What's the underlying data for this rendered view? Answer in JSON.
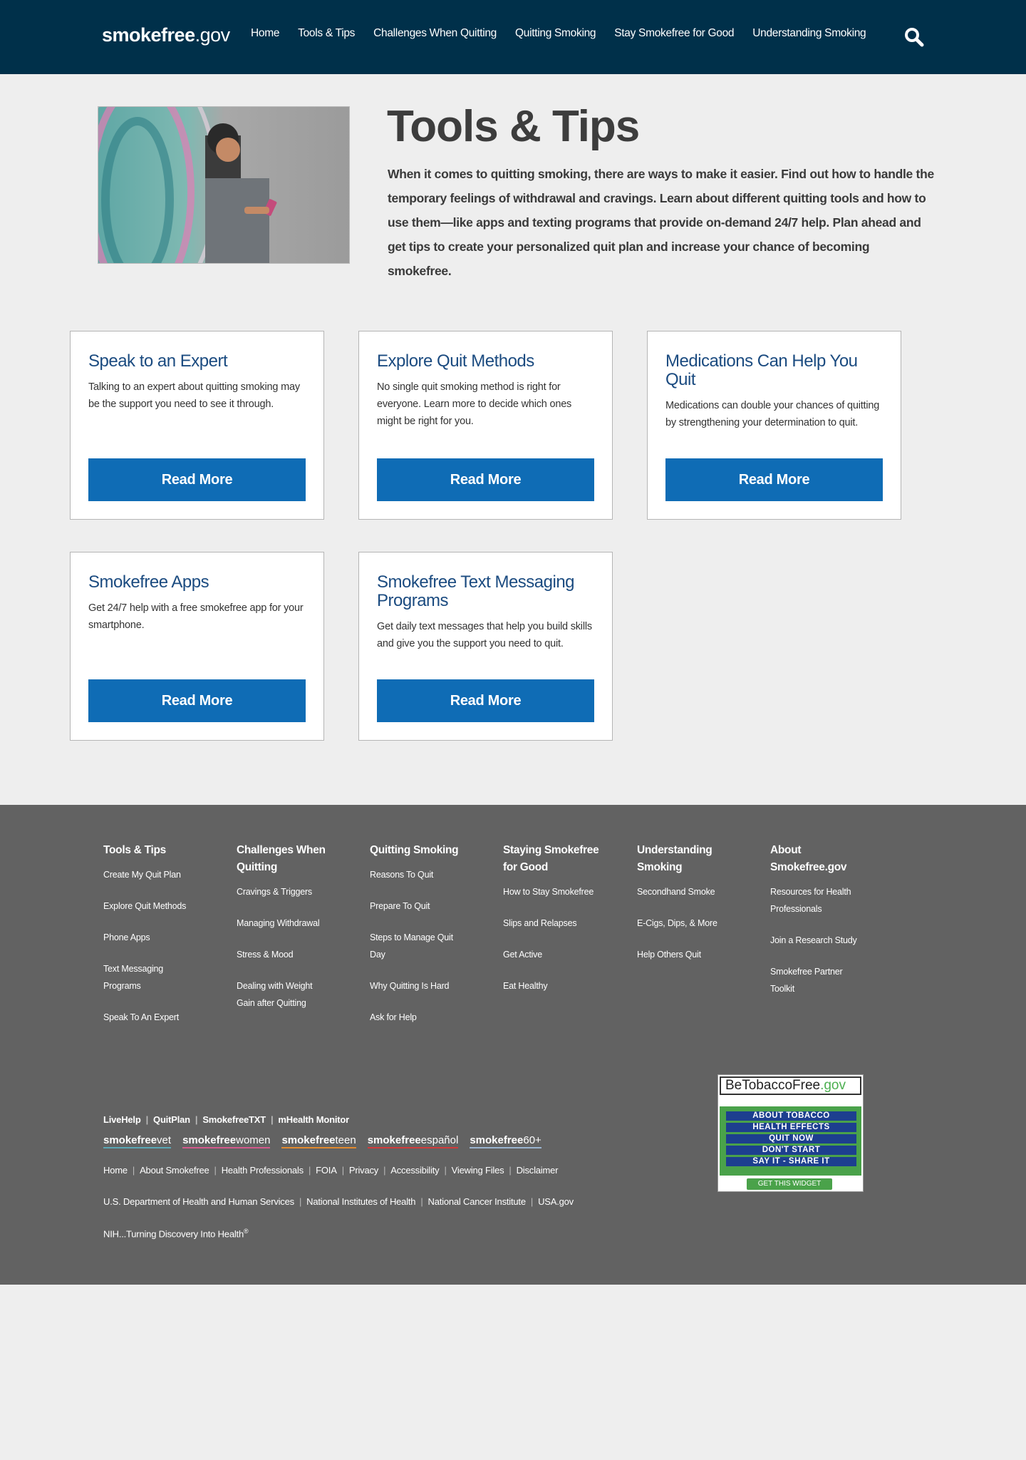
{
  "header": {
    "logo_bold": "smokefree",
    "logo_light": ".gov",
    "nav": [
      "Home",
      "Tools & Tips",
      "Challenges When Quitting",
      "Quitting Smoking",
      "Stay Smokefree for Good",
      "Understanding Smoking"
    ],
    "search_icon": "search-icon"
  },
  "hero": {
    "title": "Tools & Tips",
    "description": "When it comes to quitting smoking, there are ways to make it easier. Find out how to handle the temporary feelings of withdrawal and cravings. Learn about different quitting tools and how to use them—like apps and texting programs that provide on-demand 24/7 help. Plan ahead and get tips to create your personalized quit plan and increase your chance of becoming smokefree."
  },
  "cards": [
    {
      "title": "Speak to an Expert",
      "text": "Talking to an expert about quitting smoking may be the support you need to see it through.",
      "button": "Read More"
    },
    {
      "title": "Explore Quit Methods",
      "text": "No single quit smoking method is right for everyone. Learn more to decide which ones might be right for you.",
      "button": "Read More"
    },
    {
      "title": "Medications Can Help You Quit",
      "text": "Medications can double your chances of quitting by strengthening your determination to quit.",
      "button": "Read More"
    },
    {
      "title": "Smokefree Apps",
      "text": "Get 24/7 help with a free smokefree app for your smartphone.",
      "button": "Read More"
    },
    {
      "title": "Smokefree Text Messaging Programs",
      "text": "Get daily text messages that help you build skills and give you the support you need to quit.",
      "button": "Read More"
    }
  ],
  "footer": {
    "columns": [
      {
        "heading": "Tools & Tips",
        "links": [
          "Create My Quit Plan",
          "Explore Quit Methods",
          "Phone Apps",
          "Text Messaging Programs",
          "Speak To An Expert"
        ]
      },
      {
        "heading": "Challenges When Quitting",
        "links": [
          "Cravings & Triggers",
          "Managing Withdrawal",
          "Stress & Mood",
          "Dealing with Weight Gain after Quitting"
        ]
      },
      {
        "heading": "Quitting Smoking",
        "links": [
          "Reasons To Quit",
          "Prepare To Quit",
          "Steps to Manage Quit Day",
          "Why Quitting Is Hard",
          "Ask for Help"
        ]
      },
      {
        "heading": "Staying Smokefree for Good",
        "links": [
          "How to Stay Smokefree",
          "Slips and Relapses",
          "Get Active",
          "Eat Healthy"
        ]
      },
      {
        "heading": "Understanding Smoking",
        "links": [
          "Secondhand Smoke",
          "E-Cigs, Dips, & More",
          "Help Others Quit"
        ]
      },
      {
        "heading": "About Smokefree.gov",
        "links": [
          "Resources for Health Professionals",
          "Join a Research Study",
          "Smokefree Partner Toolkit"
        ]
      }
    ],
    "programs": [
      "LiveHelp",
      "QuitPlan",
      "SmokefreeTXT",
      "mHealth Monitor"
    ],
    "brands": [
      {
        "bold": "smokefree",
        "light": "vet",
        "color": "#5aa7b5"
      },
      {
        "bold": "smokefree",
        "light": "women",
        "color": "#d4598c"
      },
      {
        "bold": "smokefree",
        "light": "teen",
        "color": "#e28a2e"
      },
      {
        "bold": "smokefree",
        "light": "español",
        "color": "#d23b3b"
      },
      {
        "bold": "smokefree",
        "light": "60+",
        "color": "#9ab4cf"
      }
    ],
    "site_links": [
      "Home",
      "About Smokefree",
      "Health Professionals",
      "FOIA",
      "Privacy",
      "Accessibility",
      "Viewing Files",
      "Disclaimer"
    ],
    "gov_links": [
      "U.S. Department of Health and Human Services",
      "National Institutes of Health",
      "National Cancer Institute",
      "USA.gov"
    ],
    "tagline": "NIH...Turning Discovery Into Health",
    "tagline_mark": "®",
    "widget": {
      "title_a": "BeTobaccoFree",
      "title_b": ".gov",
      "items": [
        "ABOUT TOBACCO",
        "HEALTH EFFECTS",
        "QUIT NOW",
        "DON'T START",
        "SAY IT - SHARE IT"
      ],
      "button": "GET THIS WIDGET"
    }
  }
}
